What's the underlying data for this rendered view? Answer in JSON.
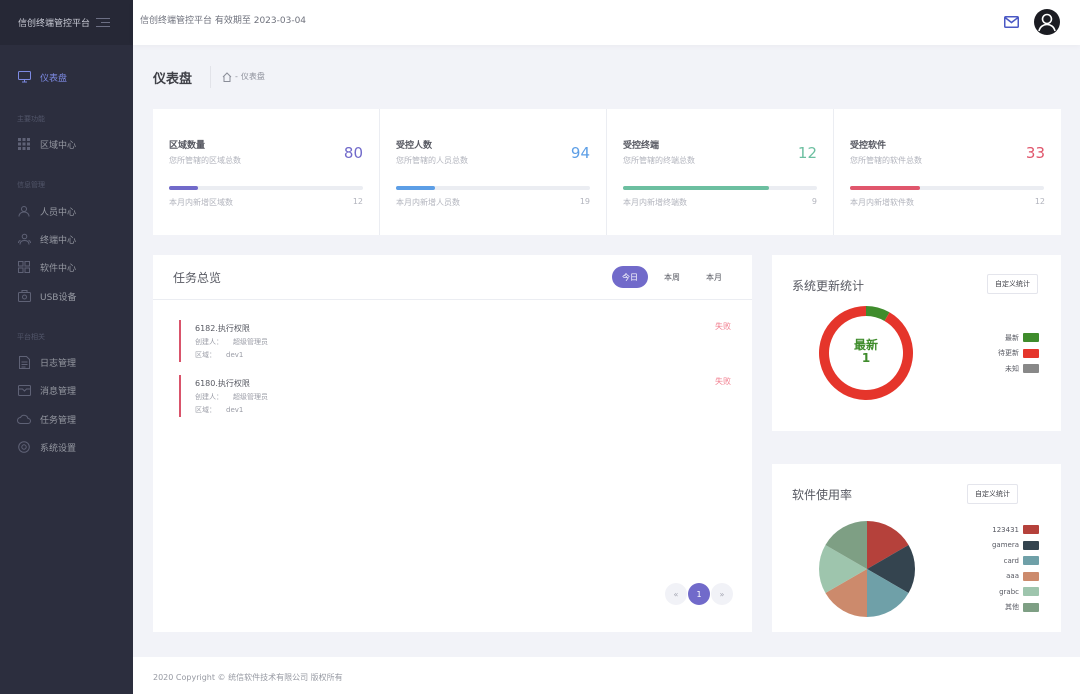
{
  "sidebar": {
    "brand": "信创终端管控平台",
    "dashboard": "仪表盘",
    "sections": [
      "主要功能",
      "信息管理",
      "平台相关"
    ],
    "items": [
      {
        "label": "区域中心"
      },
      {
        "label": "人员中心"
      },
      {
        "label": "终端中心"
      },
      {
        "label": "软件中心"
      },
      {
        "label": "USB设备"
      },
      {
        "label": "日志管理"
      },
      {
        "label": "消息管理"
      },
      {
        "label": "任务管理"
      },
      {
        "label": "系统设置"
      }
    ]
  },
  "header": {
    "info": "信创终端管控平台 有效期至 2023-03-04"
  },
  "page": {
    "title": "仪表盘",
    "breadcrumb_sep": "-",
    "breadcrumb": "仪表盘"
  },
  "stats": [
    {
      "title": "区域数量",
      "subtitle": "您所管辖的区域总数",
      "value": "80",
      "footer": "本月内新增区域数",
      "footer_value": "12",
      "progress": 0.15,
      "color": "#716aca"
    },
    {
      "title": "受控人数",
      "subtitle": "您所管辖的人员总数",
      "value": "94",
      "footer": "本月内新增人员数",
      "footer_value": "19",
      "progress": 0.2,
      "color": "#5c9ee6"
    },
    {
      "title": "受控终端",
      "subtitle": "您所管辖的终端总数",
      "value": "12",
      "footer": "本月内新增终端数",
      "footer_value": "9",
      "progress": 0.75,
      "color": "#6cbfa0"
    },
    {
      "title": "受控软件",
      "subtitle": "您所管辖的软件总数",
      "value": "33",
      "footer": "本月内新增软件数",
      "footer_value": "12",
      "progress": 0.36,
      "color": "#e0566c"
    }
  ],
  "tasks": {
    "title": "任务总览",
    "tabs": [
      "今日",
      "本周",
      "本月"
    ],
    "creator_label": "创建人：",
    "area_label": "区域：",
    "items": [
      {
        "name": "6182.执行权限",
        "creator": "超级管理员",
        "area": "dev1",
        "status": "失败"
      },
      {
        "name": "6180.执行权限",
        "creator": "超级管理员",
        "area": "dev1",
        "status": "失败"
      }
    ],
    "pager": {
      "prev": "«",
      "current": "1",
      "next": "»"
    }
  },
  "update_stats": {
    "title": "系统更新统计",
    "button": "自定义统计",
    "center_label": "最新",
    "center_value": "1",
    "legend": [
      {
        "label": "最新",
        "color": "#3f8c2c"
      },
      {
        "label": "待更新",
        "color": "#e5352b"
      },
      {
        "label": "未知",
        "color": "#888888"
      }
    ]
  },
  "software_usage": {
    "title": "软件使用率",
    "button": "自定义统计",
    "legend": [
      {
        "label": "123431",
        "color": "#b5413b"
      },
      {
        "label": "gamera",
        "color": "#34444f"
      },
      {
        "label": "card",
        "color": "#6fa0a8"
      },
      {
        "label": "aaa",
        "color": "#cc8a6c"
      },
      {
        "label": "grabc",
        "color": "#9ec5ad"
      },
      {
        "label": "其他",
        "color": "#7e9f84"
      }
    ]
  },
  "chart_data": [
    {
      "type": "pie",
      "categories": [
        "最新",
        "待更新",
        "未知"
      ],
      "values": [
        1,
        11,
        0
      ]
    },
    {
      "type": "pie",
      "categories": [
        "123431",
        "gamera",
        "card",
        "aaa",
        "grabc",
        "其他"
      ],
      "values": [
        1,
        1,
        1,
        1,
        1,
        1
      ]
    }
  ],
  "footer": {
    "copyright": "2020 Copyright © 统信软件技术有限公司 版权所有"
  }
}
